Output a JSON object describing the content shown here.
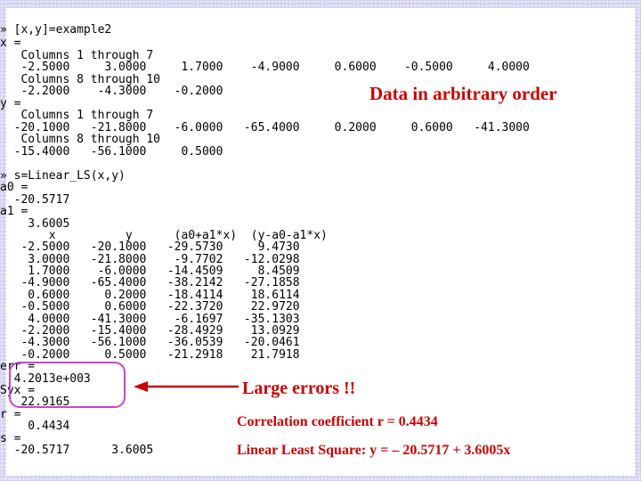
{
  "console": {
    "lines": [
      "» [x,y]=example2",
      "x =",
      "   Columns 1 through 7",
      "   -2.5000     3.0000     1.7000    -4.9000     0.6000    -0.5000     4.0000",
      "   Columns 8 through 10",
      "   -2.2000    -4.3000    -0.2000",
      "y =",
      "   Columns 1 through 7",
      "  -20.1000   -21.8000    -6.0000   -65.4000     0.2000     0.6000   -41.3000",
      "   Columns 8 through 10",
      "  -15.4000   -56.1000     0.5000",
      "",
      "» s=Linear_LS(x,y)",
      "a0 =",
      "  -20.5717",
      "a1 =",
      "    3.6005",
      "       x          y      (a0+a1*x)  (y-a0-a1*x)",
      "   -2.5000   -20.1000   -29.5730     9.4730",
      "    3.0000   -21.8000    -9.7702   -12.0298",
      "    1.7000    -6.0000   -14.4509     8.4509",
      "   -4.9000   -65.4000   -38.2142   -27.1858",
      "    0.6000     0.2000   -18.4114    18.6114",
      "   -0.5000     0.6000   -22.3720    22.9720",
      "    4.0000   -41.3000    -6.1697   -35.1303",
      "   -2.2000   -15.4000   -28.4929    13.0929",
      "   -4.3000   -56.1000   -36.0539   -20.0461",
      "   -0.2000     0.5000   -21.2918    21.7918",
      "err =",
      "  4.2013e+003",
      "Syx =",
      "   22.9165",
      "r =",
      "    0.4434",
      "s =",
      "  -20.5717      3.6005"
    ]
  },
  "annotations": {
    "data_order": "Data in arbitrary order",
    "large_errors": "Large errors !!",
    "correlation": "Correlation coefficient  r = 0.4434",
    "least_square": "Linear Least Square: y = – 20.5717 + 3.6005x"
  },
  "colors": {
    "background": "#d8d8f4",
    "console_text": "#000000",
    "annotation": "#cc0000",
    "highlight_box": "#d040d0",
    "arrow": "#cc0000"
  }
}
